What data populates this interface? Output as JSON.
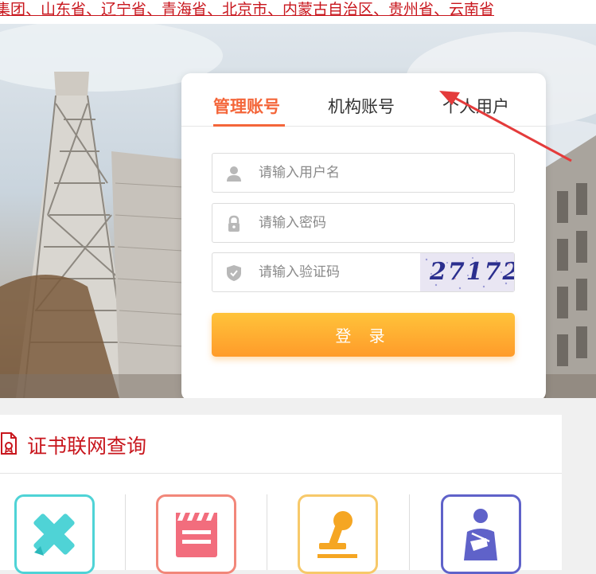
{
  "topbar": {
    "regions_text": "集团、山东省、辽宁省、青海省、北京市、内蒙古自治区、贵州省、云南省"
  },
  "login": {
    "tabs": [
      {
        "label": "管理账号",
        "active": true
      },
      {
        "label": "机构账号",
        "active": false
      },
      {
        "label": "个人用户",
        "active": false
      }
    ],
    "username_placeholder": "请输入用户名",
    "password_placeholder": "请输入密码",
    "captcha_placeholder": "请输入验证码",
    "captcha_code": "27172",
    "submit_label": "登 录"
  },
  "query": {
    "title": "证书联网查询",
    "categories": [
      {
        "icon": "tools-cross-icon",
        "color": "#4fd3d6"
      },
      {
        "icon": "clapperboard-icon",
        "color": "#f2877a"
      },
      {
        "icon": "stamp-icon",
        "color": "#f7c96a"
      },
      {
        "icon": "injured-person-icon",
        "color": "#5f62c9"
      }
    ]
  },
  "colors": {
    "accent": "#f4663a",
    "brand_red": "#c8161d",
    "button_top": "#ffc33a",
    "button_bottom": "#ff9b2a"
  }
}
